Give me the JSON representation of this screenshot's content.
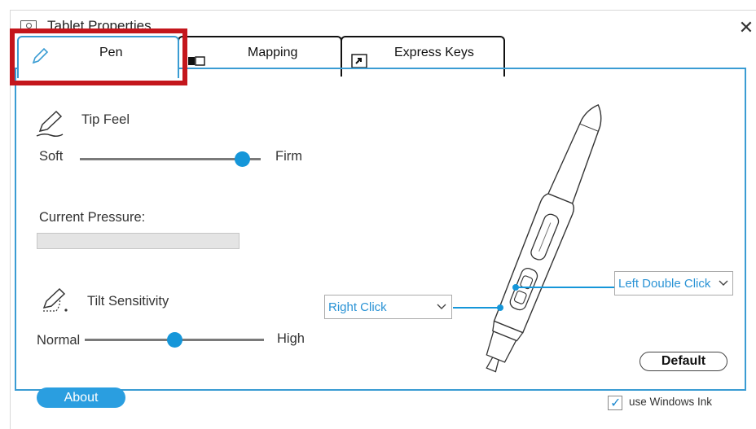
{
  "window": {
    "title": "Tablet Properties"
  },
  "tabs": [
    {
      "label": "Pen",
      "icon": "pen-icon",
      "selected": true
    },
    {
      "label": "Mapping",
      "icon": "mapping-icon"
    },
    {
      "label": "Express Keys",
      "icon": "express-keys-icon"
    }
  ],
  "tip_feel": {
    "label": "Tip Feel",
    "min_label": "Soft",
    "max_label": "Firm",
    "value_fraction": 0.9
  },
  "current_pressure": {
    "label": "Current Pressure:",
    "value_fraction": 0
  },
  "tilt": {
    "label": "Tilt Sensitivity",
    "min_label": "Normal",
    "max_label": "High",
    "value_fraction": 0.5
  },
  "buttons": {
    "lower": {
      "value": "Right Click"
    },
    "upper": {
      "value": "Left Double Click"
    }
  },
  "default_label": "Default",
  "about_label": "About",
  "windows_ink": {
    "label": "use Windows Ink",
    "checked": true
  },
  "colors": {
    "accent": "#2a9ee0",
    "highlight": "#c4161c",
    "panel_border": "#3a9cd3"
  }
}
